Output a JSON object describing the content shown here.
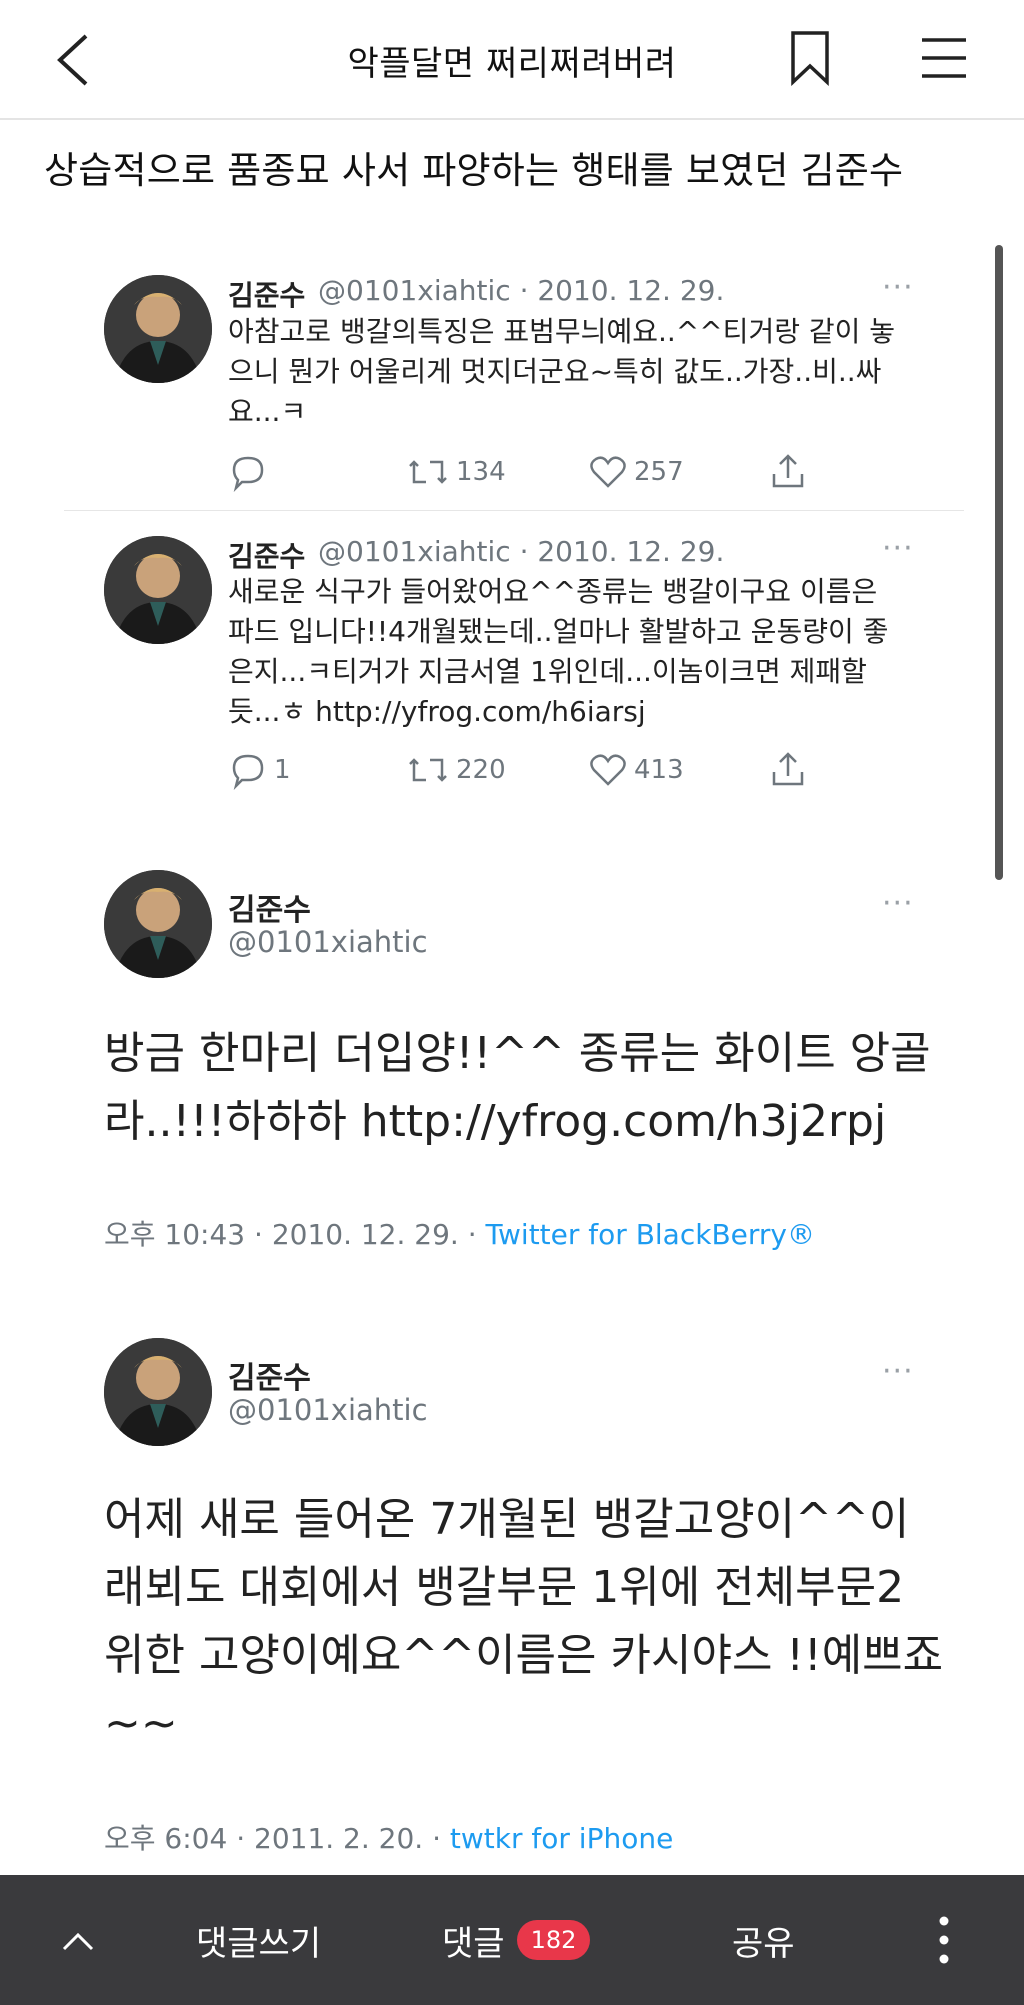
{
  "header": {
    "title": "악플달면 쩌리쩌려버려"
  },
  "post": {
    "title": "상습적으로 품종묘 사서 파양하는 행태를 보였던 김준수"
  },
  "tweets_small": [
    {
      "name": "김준수",
      "meta": "@0101xiahtic · 2010. 12. 29.",
      "more": "···",
      "lines": [
        "아참고로 뱅갈의특징은 표범무늬예요..^^티거랑 같이 놓",
        "으니 뭔가 어울리게 멋지더군요~특히 값도..가장..비..싸",
        "요...ㅋ"
      ],
      "reply_count": "",
      "retweet_count": "134",
      "like_count": "257"
    },
    {
      "name": "김준수",
      "meta": "@0101xiahtic · 2010. 12. 29.",
      "more": "···",
      "lines": [
        "새로운 식구가 들어왔어요^^종류는 뱅갈이구요 이름은",
        "파드 입니다!!4개월됐는데..얼마나 활발하고 운동량이 좋",
        "은지...ㅋ티거가 지금서열 1위인데...이놈이크면 제패할",
        "듯...ㅎ http://yfrog.com/h6iarsj"
      ],
      "reply_count": "1",
      "retweet_count": "220",
      "like_count": "413"
    }
  ],
  "tweets_big": [
    {
      "name": "김준수",
      "handle": "@0101xiahtic",
      "more": "···",
      "lines": [
        "방금 한마리 더입양!!^^ 종류는 화이트 앙골",
        "라..!!!하하하 http://yfrog.com/h3j2rpj"
      ],
      "time": "오후 10:43 · 2010. 12. 29. · ",
      "source": "Twitter for BlackBerry®"
    },
    {
      "name": "김준수",
      "handle": "@0101xiahtic",
      "more": "···",
      "lines": [
        "어제 새로 들어온 7개월된 뱅갈고양이^^이",
        "래뵈도 대회에서 뱅갈부문 1위에 전체부문2",
        "위한 고양이예요^^이름은 카시야스 !!예쁘죠",
        "~~"
      ],
      "time": "오후 6:04 · 2011. 2. 20. · ",
      "source": "twtkr for iPhone"
    }
  ],
  "bottom": {
    "write_label": "댓글쓰기",
    "comments_label": "댓글",
    "comments_count": "182",
    "share_label": "공유"
  },
  "colors": {
    "link": "#1d9bf0",
    "badge": "#e8374a",
    "bottom_bar": "#3a3a3d"
  }
}
